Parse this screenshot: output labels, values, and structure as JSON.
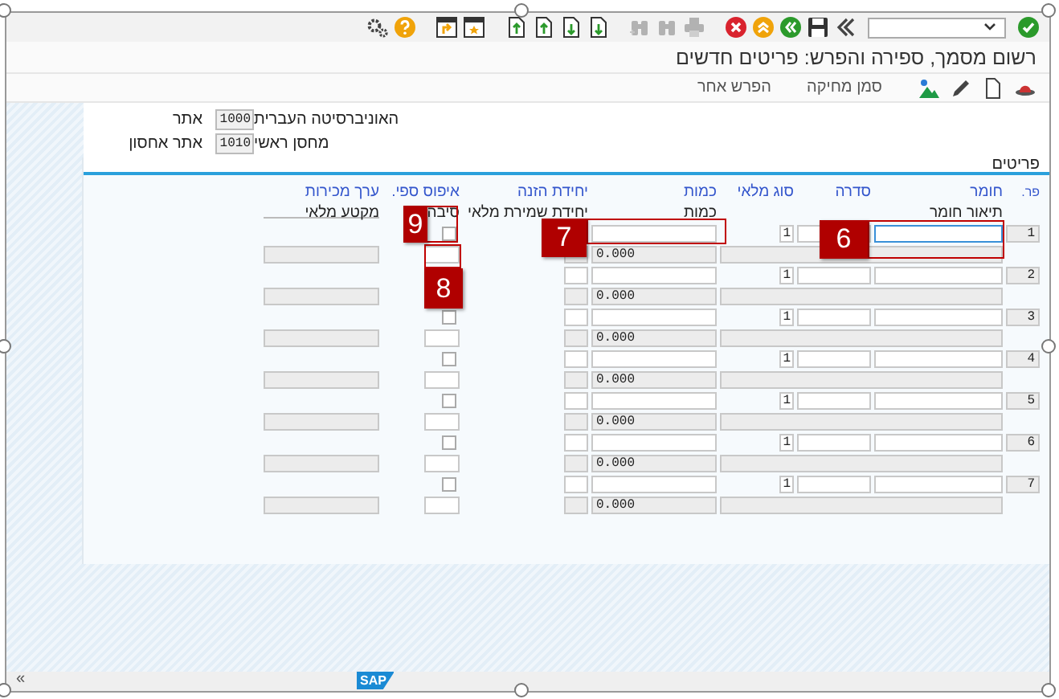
{
  "system_toolbar": [
    {
      "kind": "enter",
      "disabled": false
    },
    {
      "kind": "command-field",
      "disabled": false
    },
    {
      "kind": "more",
      "disabled": false
    },
    {
      "kind": "save",
      "disabled": false
    },
    {
      "kind": "back",
      "disabled": false
    },
    {
      "kind": "exit",
      "disabled": false
    },
    {
      "kind": "cancel",
      "disabled": false
    },
    {
      "kind": "print",
      "disabled": true
    },
    {
      "kind": "find",
      "disabled": true
    },
    {
      "kind": "find-next",
      "disabled": true
    },
    {
      "kind": "first-page",
      "disabled": false
    },
    {
      "kind": "previous-page",
      "disabled": false
    },
    {
      "kind": "next-page",
      "disabled": false
    },
    {
      "kind": "last-page",
      "disabled": false
    },
    {
      "kind": "new-session",
      "disabled": false
    },
    {
      "kind": "shortcut",
      "disabled": false
    },
    {
      "kind": "help",
      "disabled": false
    },
    {
      "kind": "settings",
      "disabled": false
    }
  ],
  "window": {
    "title": "רשום מסמך, ספירה והפרש: פריטים חדשים"
  },
  "app_toolbar": [
    {
      "kind": "hat"
    },
    {
      "kind": "document"
    },
    {
      "kind": "pencil"
    },
    {
      "kind": "mountain"
    },
    {
      "kind": "text",
      "label": "סמן מחיקה"
    },
    {
      "kind": "text",
      "label": "הפרש אחר"
    }
  ],
  "header_fields": [
    {
      "label": "אתר",
      "value": "1000",
      "description": "האוניברסיטה העברית"
    },
    {
      "label": "אתר אחסון",
      "value": "1010",
      "description": "מחסן ראשי"
    }
  ],
  "items": {
    "title": "פריטים",
    "columns_line1": [
      "פר.",
      "חומר",
      "סדרה",
      "סוג מלאי",
      "כמות",
      "יחידת הזנה",
      "איפוס ספי.",
      "ערך מכירות"
    ],
    "columns_line2": [
      "תיאור חומר",
      "כמות",
      "יחידת שמירת מלאי",
      "סיבה",
      "מקטע מלאי"
    ],
    "rows": [
      {
        "item": "1",
        "stock_type": "1",
        "quantity": "0.000",
        "focused": true,
        "reset": false
      },
      {
        "item": "2",
        "stock_type": "1",
        "quantity": "0.000",
        "focused": false
      },
      {
        "item": "3",
        "stock_type": "1",
        "quantity": "0.000",
        "focused": false,
        "reset": false
      },
      {
        "item": "4",
        "stock_type": "1",
        "quantity": "0.000",
        "focused": false,
        "reset": false
      },
      {
        "item": "5",
        "stock_type": "1",
        "quantity": "0.000",
        "focused": false,
        "reset": false
      },
      {
        "item": "6",
        "stock_type": "1",
        "quantity": "0.000",
        "focused": false,
        "reset": false
      },
      {
        "item": "7",
        "stock_type": "1",
        "quantity": "0.000",
        "focused": false,
        "reset": false
      }
    ]
  },
  "callouts": [
    "6",
    "7",
    "8",
    "9"
  ],
  "status_bar": {
    "collapse": "«",
    "logo": "SAP"
  }
}
